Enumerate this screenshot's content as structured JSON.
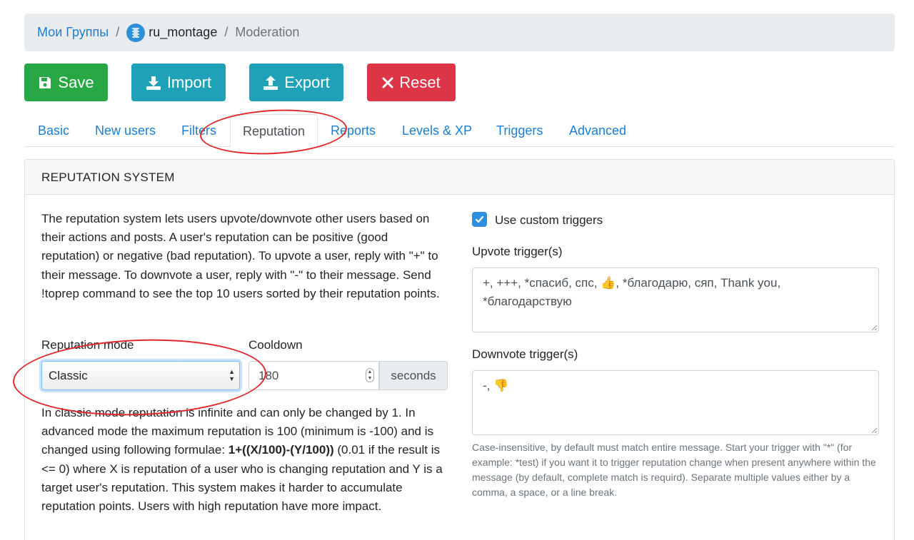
{
  "breadcrumb": {
    "root": "Мои Группы",
    "separator": "/",
    "group": "ru_montage",
    "current": "Moderation"
  },
  "toolbar": {
    "save_label": "Save",
    "import_label": "Import",
    "export_label": "Export",
    "reset_label": "Reset"
  },
  "tabs": [
    {
      "label": "Basic"
    },
    {
      "label": "New users"
    },
    {
      "label": "Filters"
    },
    {
      "label": "Reputation"
    },
    {
      "label": "Reports"
    },
    {
      "label": "Levels & XP"
    },
    {
      "label": "Triggers"
    },
    {
      "label": "Advanced"
    }
  ],
  "active_tab": "Reputation",
  "section": {
    "title": "REPUTATION SYSTEM",
    "description": "The reputation system lets users upvote/downvote other users based on their actions and posts. A user's reputation can be positive (good reputation) or negative (bad reputation). To upvote a user, reply with \"+\" to their message. To downvote a user, reply with \"-\" to their message. Send !toprep command to see the top 10 users sorted by their reputation points.",
    "mode_label": "Reputation mode",
    "mode_value": "Classic",
    "cooldown_label": "Cooldown",
    "cooldown_value": "180",
    "cooldown_unit": "seconds",
    "mode_help_1": "In classic mode reputation is infinite and can only be changed by 1. In advanced mode the maximum reputation is 100 (minimum is -100) and is changed using following formulae: ",
    "mode_help_formula": "1+((X/100)-(Y/100))",
    "mode_help_2": " (0.01 if the result is <= 0) where X is reputation of a user who is changing reputation and Y is a target user's reputation. This system makes it harder to accumulate reputation points. Users with high reputation have more impact.",
    "custom_triggers_label": "Use custom triggers",
    "custom_triggers_checked": true,
    "upvote_label": "Upvote trigger(s)",
    "upvote_value": "+, +++, *спасиб, спс, 👍, *благодарю, сяп, Thank you, *благодарствую",
    "downvote_label": "Downvote trigger(s)",
    "downvote_value": "-, 👎",
    "trigger_help": "Case-insensitive, by default must match entire message. Start your trigger with \"*\" (for example: *test) if you want it to trigger reputation change when present anywhere within the message (by default, complete match is requird). Separate multiple values either by a comma, a space, or a line break."
  },
  "colors": {
    "primary_link": "#1a7fd4",
    "save": "#28a745",
    "import_export": "#1fa2b8",
    "reset": "#dc3545",
    "annotation": "#e0272b"
  }
}
